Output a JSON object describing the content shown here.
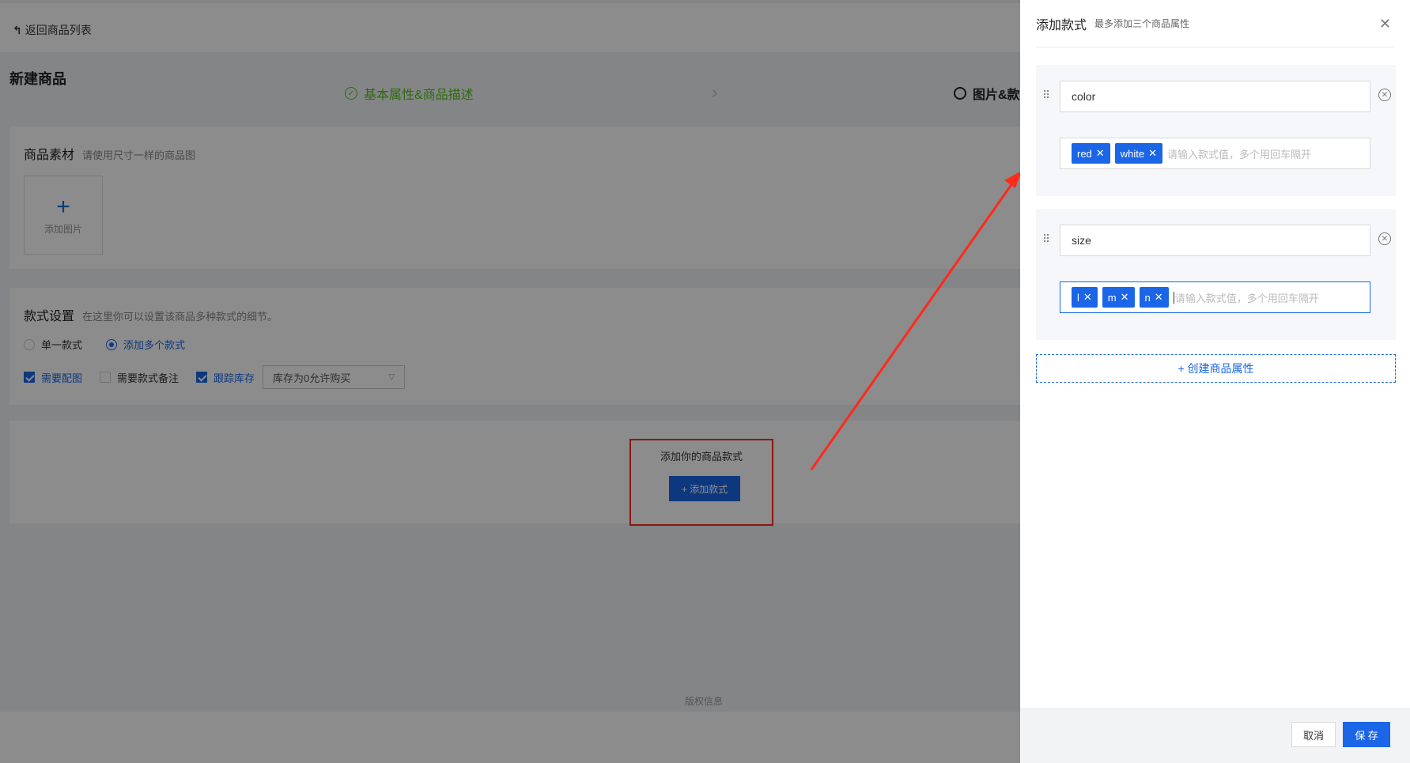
{
  "page": {
    "back_label": "返回商品列表",
    "title": "新建商品",
    "steps": {
      "done": "基本属性&商品描述",
      "todo": "图片&款"
    },
    "material": {
      "title": "商品素材",
      "hint": "请使用尺寸一样的商品图",
      "upload_label": "添加图片"
    },
    "style_settings": {
      "title": "款式设置",
      "hint": "在这里你可以设置该商品多种款式的细节。",
      "radio_single": "单一款式",
      "radio_multi": "添加多个款式",
      "check_image": "需要配图",
      "check_note": "需要款式备注",
      "check_stock": "跟踪库存",
      "stock_select": "库存为0允许购买"
    },
    "add_styles": {
      "title": "添加你的商品款式",
      "button": "+ 添加款式"
    },
    "copyright": "版权信息"
  },
  "drawer": {
    "title": "添加款式",
    "subtitle": "最多添加三个商品属性",
    "attributes": [
      {
        "name": "color",
        "tags": [
          "red",
          "white"
        ],
        "placeholder": "请输入款式值，多个用回车隔开"
      },
      {
        "name": "size",
        "tags": [
          "l",
          "m",
          "n"
        ],
        "placeholder": "请输入款式值，多个用回车隔开"
      }
    ],
    "create_attr": "+ 创建商品属性",
    "cancel": "取消",
    "save": "保 存"
  },
  "colors": {
    "primary": "#1a66e6",
    "success": "#52c41a",
    "annotation": "#ff2a1a"
  }
}
